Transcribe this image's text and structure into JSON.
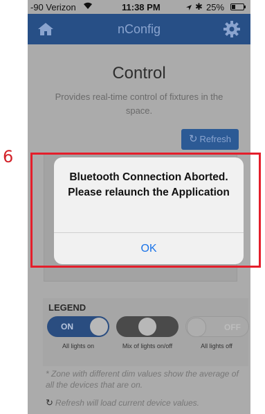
{
  "annotation": {
    "number": "6",
    "highlight_color": "#e41e2b"
  },
  "status_bar": {
    "carrier": "-90 Verizon",
    "time": "11:38 PM",
    "battery": "25%"
  },
  "navbar": {
    "title": "nConfig",
    "home_icon": "home-icon",
    "settings_icon": "gear-icon",
    "color": "#274f86"
  },
  "page": {
    "title": "Control",
    "description": "Provides real-time control of fixtures in the space.",
    "refresh_label": "Refresh"
  },
  "alert": {
    "message": "Bluetooth Connection Aborted. Please relaunch the Application",
    "ok_label": "OK"
  },
  "legend": {
    "title": "LEGEND",
    "items": [
      {
        "toggle_label": "ON",
        "caption": "All lights on"
      },
      {
        "toggle_label": "",
        "caption": "Mix of lights on/off"
      },
      {
        "toggle_label": "OFF",
        "caption": "All lights off"
      }
    ],
    "note": "* Zone with different dim values show the average of all the devices that are on.",
    "refresh_note": "Refresh will load current device values."
  }
}
